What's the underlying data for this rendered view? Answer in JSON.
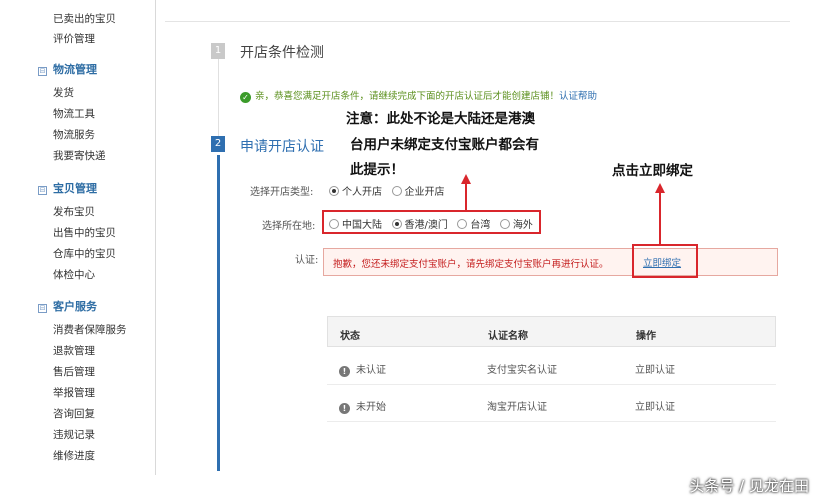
{
  "sidebar": {
    "items_top": [
      "已卖出的宝贝",
      "评价管理"
    ],
    "groups": [
      {
        "title": "物流管理",
        "items": [
          "发货",
          "物流工具",
          "物流服务",
          "我要寄快递"
        ]
      },
      {
        "title": "宝贝管理",
        "items": [
          "发布宝贝",
          "出售中的宝贝",
          "仓库中的宝贝",
          "体检中心"
        ]
      },
      {
        "title": "客户服务",
        "items": [
          "消费者保障服务",
          "退款管理",
          "售后管理",
          "举报管理",
          "咨询回复",
          "违规记录",
          "维修进度"
        ]
      }
    ],
    "collapse_symbol": "⊟"
  },
  "step1": {
    "num": "1",
    "title": "开店条件检测"
  },
  "ok_message": {
    "text": "亲，恭喜您满足开店条件，请继续完成下面的开店认证后才能创建店铺！",
    "link": "认证帮助"
  },
  "step2": {
    "num": "2",
    "title": "申请开店认证"
  },
  "annotation1": {
    "line1": "注意：此处不论是大陆还是港澳",
    "line2": "台用户未绑定支付宝账户都会有",
    "line3": "此提示！"
  },
  "annotation2": "点击立即绑定",
  "form": {
    "shop_type_label": "选择开店类型:",
    "shop_types": [
      {
        "label": "个人开店",
        "checked": true
      },
      {
        "label": "企业开店",
        "checked": false
      }
    ],
    "region_label": "选择所在地:",
    "regions": [
      {
        "label": "中国大陆",
        "checked": false
      },
      {
        "label": "香港/澳门",
        "checked": true
      },
      {
        "label": "台湾",
        "checked": false
      },
      {
        "label": "海外",
        "checked": false
      }
    ],
    "cert_label": "认证:",
    "warning": "抱歉，您还未绑定支付宝账户，请先绑定支付宝账户再进行认证。",
    "bind_link": "立即绑定"
  },
  "table": {
    "headers": [
      "状态",
      "认证名称",
      "操作"
    ],
    "rows": [
      {
        "status": "未认证",
        "name": "支付宝实名认证",
        "action": "立即认证"
      },
      {
        "status": "未开始",
        "name": "淘宝开店认证",
        "action": "立即认证"
      }
    ],
    "info_icon_glyph": "!"
  },
  "watermark": "头条号 / 见龙在田",
  "colors": {
    "accent": "#2f6fb0",
    "annotation_red": "#d9262c",
    "warning_text": "#c41d1d",
    "ok_green": "#3b9b2a"
  }
}
